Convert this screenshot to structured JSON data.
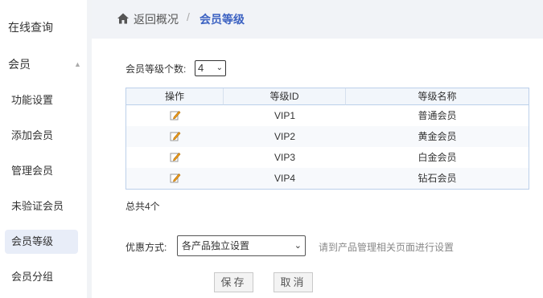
{
  "sidebar": {
    "top_item": "在线查询",
    "group": "会员",
    "items": [
      {
        "label": "功能设置"
      },
      {
        "label": "添加会员"
      },
      {
        "label": "管理会员"
      },
      {
        "label": "未验证会员"
      },
      {
        "label": "会员等级",
        "active": true
      },
      {
        "label": "会员分组"
      }
    ]
  },
  "breadcrumb": {
    "back": "返回概况",
    "separator": "/",
    "current": "会员等级"
  },
  "level_count": {
    "label": "会员等级个数:",
    "value": "4"
  },
  "table": {
    "headers": [
      "操作",
      "等级ID",
      "等级名称"
    ],
    "rows": [
      {
        "id": "VIP1",
        "name": "普通会员"
      },
      {
        "id": "VIP2",
        "name": "黄金会员"
      },
      {
        "id": "VIP3",
        "name": "白金会员"
      },
      {
        "id": "VIP4",
        "name": "钻石会员"
      }
    ]
  },
  "total": "总共4个",
  "discount": {
    "label": "优惠方式:",
    "value": "各产品独立设置",
    "hint": "请到产品管理相关页面进行设置"
  },
  "buttons": {
    "save": "保存",
    "cancel": "取消"
  },
  "colors": {
    "accent": "#3c62c2",
    "active_bg": "#e8edf8",
    "table_border": "#bcd0ea"
  }
}
